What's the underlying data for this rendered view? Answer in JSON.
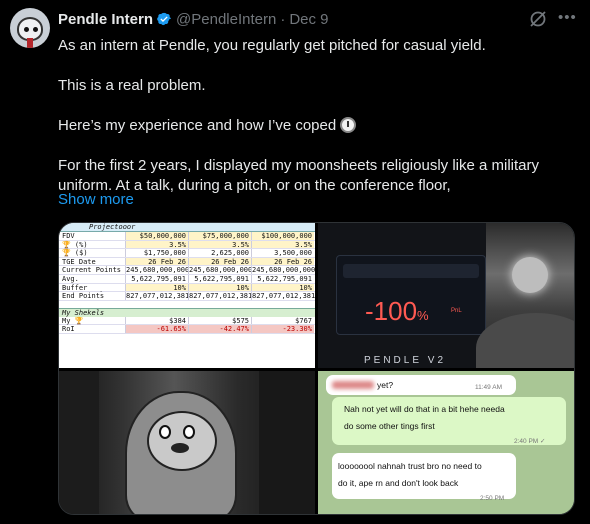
{
  "author": {
    "name": "Pendle Intern",
    "handle": "@PendleIntern",
    "separator": "·",
    "date": "Dec 9"
  },
  "tweet": {
    "line1": "As an intern at Pendle, you regularly get pitched for casual yield.",
    "line2": "This is a real problem.",
    "line3": "Here’s my experience and how I’ve coped",
    "line4": "For the first 2 years, I displayed my moonsheets religiously like a military uniform. At a talk, during a pitch, or on the conference floor,",
    "show_more": "Show more"
  },
  "colors": {
    "accent": "#1d9bf0",
    "verified": "#1d9bf0",
    "pnl_red": "#ff5a52"
  },
  "icons": {
    "verified": "verified-badge-icon",
    "grok": "grok-icon",
    "more": "more-icon",
    "clock": "stopwatch-emoji"
  },
  "sheet": {
    "title": "Projectooor",
    "rows": [
      {
        "label": "FDV",
        "v": [
          "$50,000,000",
          "$75,000,000",
          "$100,000,000"
        ],
        "style": "hl"
      },
      {
        "label": "🏆 (%)",
        "v": [
          "3.5%",
          "3.5%",
          "3.5%"
        ],
        "style": "hl"
      },
      {
        "label": "🏆 ($)",
        "v": [
          "$1,750,000",
          "2,625,000",
          "3,500,000"
        ],
        "style": ""
      },
      {
        "label": "TGE Date",
        "v": [
          "26 Feb 26",
          "26 Feb 26",
          "26 Feb 26"
        ],
        "style": "hl"
      },
      {
        "label": "Current Points",
        "v": [
          "245,680,000,000",
          "245,680,000,000",
          "245,680,000,000"
        ],
        "style": ""
      },
      {
        "label": "Avg. Points/Day",
        "v": [
          "5,622,795,091",
          "5,622,795,091",
          "5,622,795,091"
        ],
        "style": ""
      },
      {
        "label": "Buffer",
        "v": [
          "10%",
          "10%",
          "10%"
        ],
        "style": "hl"
      },
      {
        "label": "End Points",
        "v": [
          "827,077,012,381",
          "827,077,012,381",
          "827,077,012,381"
        ],
        "style": ""
      }
    ],
    "shekels_title": "My Shekels",
    "my_row": {
      "label": "My 🏆",
      "v": [
        "$384",
        "$575",
        "$767"
      ]
    },
    "roi_row": {
      "label": "RoI",
      "v": [
        "-61.65%",
        "-42.47%",
        "-23.30%"
      ]
    }
  },
  "pendle": {
    "pnl_value": "-100",
    "pnl_percent": "%",
    "pnl_label": "PnL",
    "logo": "PENDLE V2"
  },
  "chat": {
    "m1": "yet?",
    "m1_time": "11:49 AM",
    "m2_line1": "Nah not yet will do that in a bit hehe needa",
    "m2_line2": "do some other tings first",
    "m2_time": "2:40 PM ✓",
    "m3_line1": "loooooool nahnah trust bro no need to",
    "m3_line2": "do it, ape rn and don't look back",
    "m3_time": "2:50 PM"
  }
}
